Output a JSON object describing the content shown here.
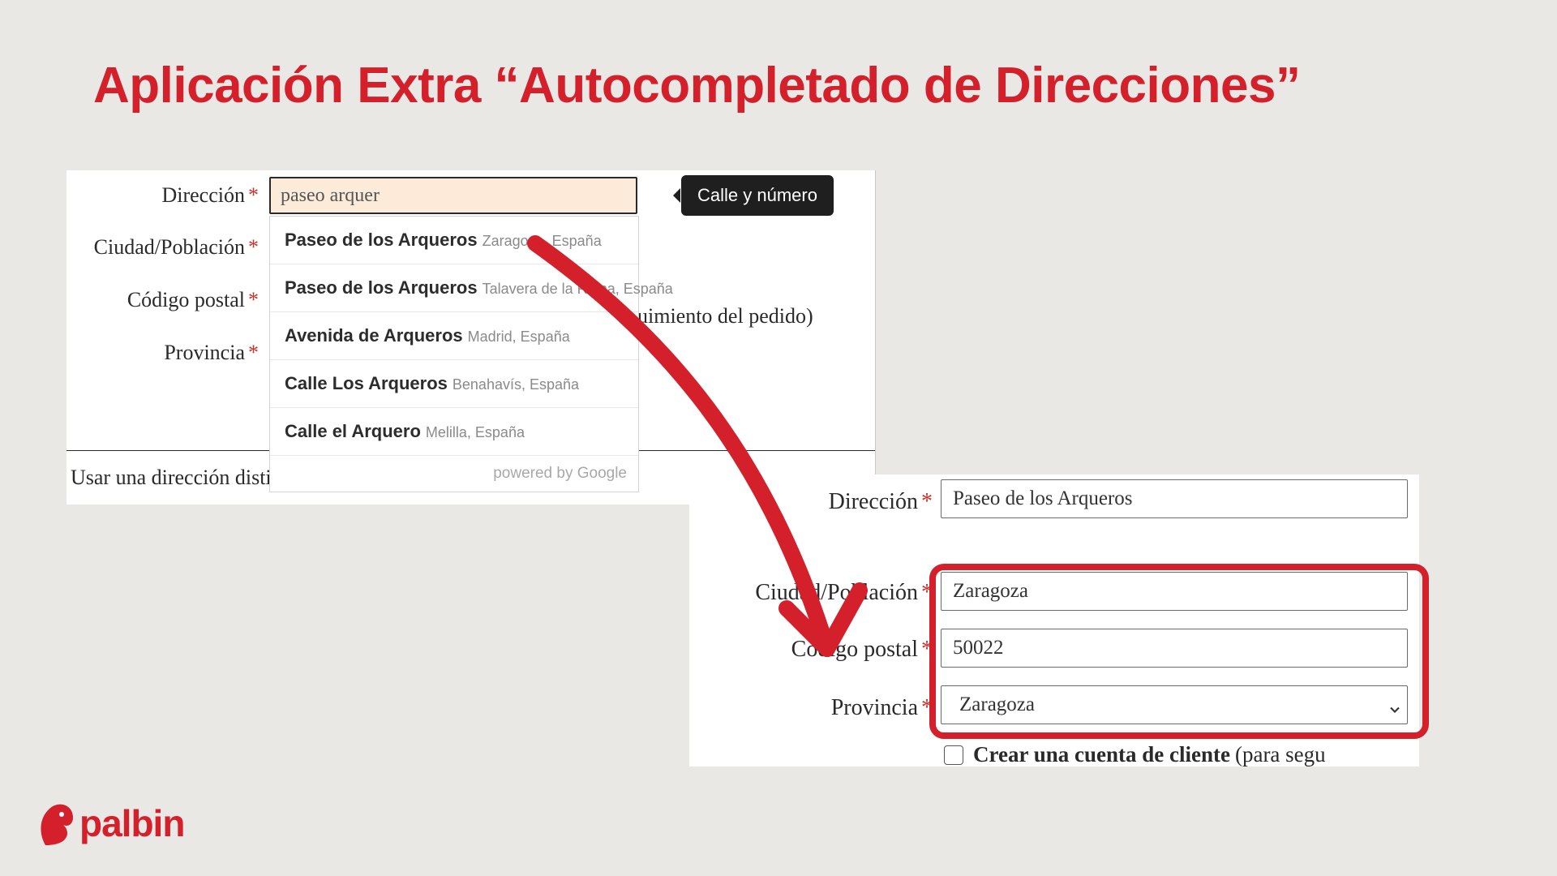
{
  "title": "Aplicación Extra “Autocompletado de Direcciones”",
  "panel_a": {
    "labels": {
      "direccion": "Dirección",
      "ciudad": "Ciudad/Población",
      "cp": "Código postal",
      "provincia": "Provincia"
    },
    "direccion_value": "paseo arquer",
    "tooltip": "Calle y número",
    "suggestions": [
      {
        "main": "Paseo de los Arqueros",
        "sub": "Zaragoza, España"
      },
      {
        "main": "Paseo de los Arqueros",
        "sub": "Talavera de la Reina, España"
      },
      {
        "main": "Avenida de Arqueros",
        "sub": "Madrid, España"
      },
      {
        "main": "Calle Los Arqueros",
        "sub": "Benahavís, España"
      },
      {
        "main": "Calle el Arquero",
        "sub": "Melilla, España"
      }
    ],
    "powered": "powered by Google",
    "after_text": "uimiento del pedido)",
    "use_other": "Usar una dirección distinta"
  },
  "panel_b": {
    "labels": {
      "direccion": "Dirección",
      "ciudad": "Ciudad/Población",
      "cp": "Código postal",
      "provincia": "Provincia"
    },
    "direccion_value": "Paseo de los Arqueros",
    "ciudad_value": "Zaragoza",
    "cp_value": "50022",
    "provincia_value": "Zaragoza",
    "check_strong": "Crear una cuenta de cliente",
    "check_rest": "(para segu"
  },
  "brand": "palbin"
}
